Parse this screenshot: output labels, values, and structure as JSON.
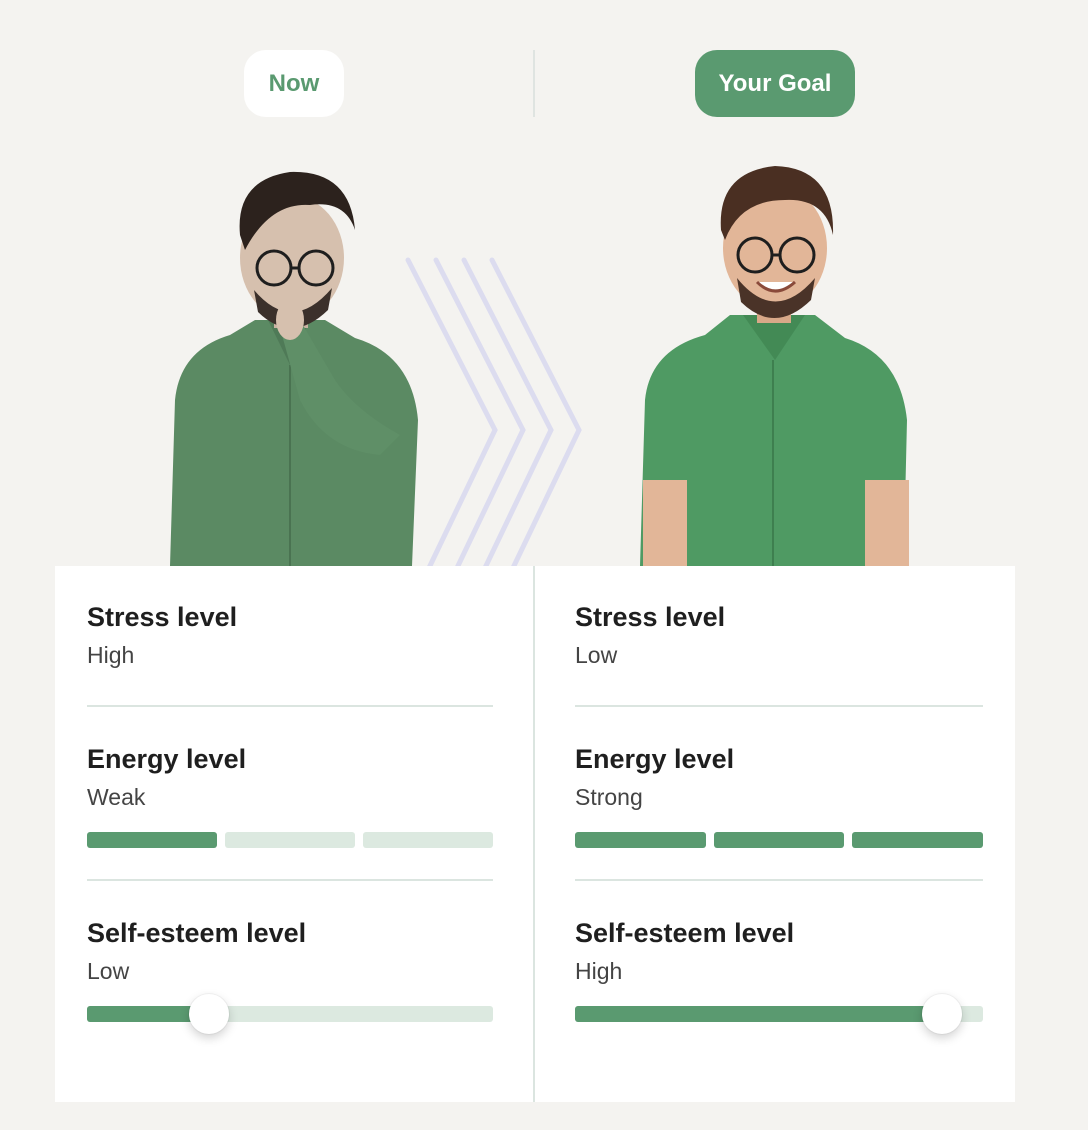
{
  "tabs": {
    "now_label": "Now",
    "goal_label": "Your Goal"
  },
  "colors": {
    "accent": "#5a9a70",
    "track": "#dce9e0",
    "background": "#f4f3f0"
  },
  "now": {
    "stress": {
      "title": "Stress level",
      "value": "High"
    },
    "energy": {
      "title": "Energy level",
      "value": "Weak",
      "segments_filled": 1,
      "segments_total": 3
    },
    "self_esteem": {
      "title": "Self-esteem level",
      "value": "Low",
      "level": 0.3
    }
  },
  "goal": {
    "stress": {
      "title": "Stress level",
      "value": "Low"
    },
    "energy": {
      "title": "Energy level",
      "value": "Strong",
      "segments_filled": 3,
      "segments_total": 3
    },
    "self_esteem": {
      "title": "Self-esteem level",
      "value": "High",
      "level": 0.9
    }
  }
}
